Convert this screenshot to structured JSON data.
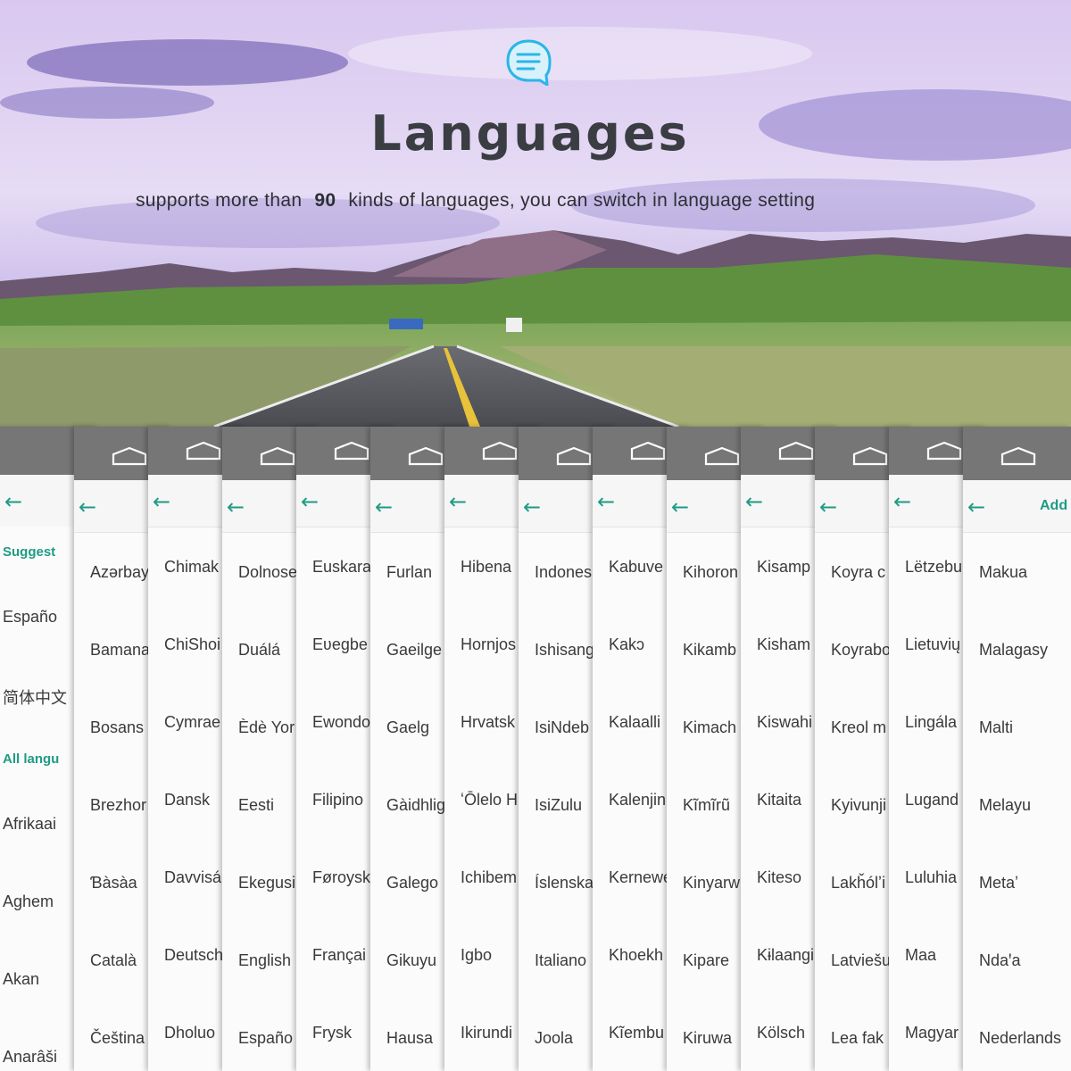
{
  "header": {
    "icon": "chat-bubble-icon",
    "title": "Languages",
    "subtitle_before": "supports more than",
    "language_count": "90",
    "subtitle_after": "kinds of languages, you can switch in language setting"
  },
  "colors": {
    "accent": "#1f9b84",
    "nav_bar": "#767676",
    "title": "#3a3d42",
    "icon": "#29b6e8"
  },
  "panels": [
    {
      "header_extra": "",
      "items": [
        {
          "label": "Suggest",
          "section": true
        },
        {
          "label": "Españo"
        },
        {
          "label": "简体中文"
        },
        {
          "label": "All langu",
          "section": true
        },
        {
          "label": "Afrikaai"
        },
        {
          "label": "Aghem"
        },
        {
          "label": "Akan"
        },
        {
          "label": "Anarâši"
        }
      ]
    },
    {
      "header_extra": "",
      "items": [
        {
          "label": "Azərbay"
        },
        {
          "label": "Bamana"
        },
        {
          "label": "Bosans"
        },
        {
          "label": "Brezhor"
        },
        {
          "label": "Ɓàsàa"
        },
        {
          "label": "Català"
        },
        {
          "label": "Čeština"
        }
      ]
    },
    {
      "header_extra": "",
      "items": [
        {
          "label": "Chimak"
        },
        {
          "label": "ChiShoi"
        },
        {
          "label": "Cymrae"
        },
        {
          "label": "Dansk"
        },
        {
          "label": "Davvisá"
        },
        {
          "label": "Deutsch"
        },
        {
          "label": "Dholuo"
        }
      ]
    },
    {
      "header_extra": "",
      "items": [
        {
          "label": "Dolnose"
        },
        {
          "label": "Duálá"
        },
        {
          "label": "Èdè Yor"
        },
        {
          "label": "Eesti"
        },
        {
          "label": "Ekegusi"
        },
        {
          "label": "English"
        },
        {
          "label": "Españo"
        }
      ]
    },
    {
      "header_extra": "",
      "items": [
        {
          "label": "Euskara"
        },
        {
          "label": "Eʋegbe"
        },
        {
          "label": "Ewondo"
        },
        {
          "label": "Filipino"
        },
        {
          "label": "Føroysk"
        },
        {
          "label": "Françai"
        },
        {
          "label": "Frysk"
        }
      ]
    },
    {
      "header_extra": "",
      "items": [
        {
          "label": "Furlan"
        },
        {
          "label": "Gaeilge"
        },
        {
          "label": "Gaelg"
        },
        {
          "label": "Gàidhlig"
        },
        {
          "label": "Galego"
        },
        {
          "label": "Gikuyu"
        },
        {
          "label": "Hausa"
        }
      ]
    },
    {
      "header_extra": "",
      "items": [
        {
          "label": "Hibena"
        },
        {
          "label": "Hornjos"
        },
        {
          "label": "Hrvatsk"
        },
        {
          "label": "ʻŌlelo H"
        },
        {
          "label": "Ichibem"
        },
        {
          "label": "Igbo"
        },
        {
          "label": "Ikirundi"
        }
      ]
    },
    {
      "header_extra": "",
      "items": [
        {
          "label": "Indones"
        },
        {
          "label": "Ishisang"
        },
        {
          "label": "IsiNdeb"
        },
        {
          "label": "IsiZulu"
        },
        {
          "label": "Íslenska"
        },
        {
          "label": "Italiano"
        },
        {
          "label": "Joola"
        }
      ]
    },
    {
      "header_extra": "",
      "items": [
        {
          "label": "Kabuve"
        },
        {
          "label": "Kakɔ"
        },
        {
          "label": "Kalaalli"
        },
        {
          "label": "Kalenjin"
        },
        {
          "label": "Kernewe"
        },
        {
          "label": "Khoekh"
        },
        {
          "label": "Kĩembu"
        }
      ]
    },
    {
      "header_extra": "",
      "items": [
        {
          "label": "Kihoron"
        },
        {
          "label": "Kikamb"
        },
        {
          "label": "Kimach"
        },
        {
          "label": "Kĩmĩrũ"
        },
        {
          "label": "Kinyarw"
        },
        {
          "label": "Kipare"
        },
        {
          "label": "Kiruwa"
        }
      ]
    },
    {
      "header_extra": "",
      "items": [
        {
          "label": "Kisamp"
        },
        {
          "label": "Kisham"
        },
        {
          "label": "Kiswahi"
        },
        {
          "label": "Kitaita"
        },
        {
          "label": "Kiteso"
        },
        {
          "label": "Kɨlaangi"
        },
        {
          "label": "Kölsch"
        }
      ]
    },
    {
      "header_extra": "",
      "items": [
        {
          "label": "Koyra c"
        },
        {
          "label": "Koyrabo"
        },
        {
          "label": "Kreol m"
        },
        {
          "label": "Kyivunji"
        },
        {
          "label": "Lakȟólʼi"
        },
        {
          "label": "Latviešu"
        },
        {
          "label": "Lea fak"
        }
      ]
    },
    {
      "header_extra": "",
      "items": [
        {
          "label": "Lëtzebu"
        },
        {
          "label": "Lietuvių"
        },
        {
          "label": "Lingála"
        },
        {
          "label": "Lugand"
        },
        {
          "label": "Luluhia"
        },
        {
          "label": "Maa"
        },
        {
          "label": "Magyar"
        }
      ]
    },
    {
      "header_extra": "Add a la",
      "items": [
        {
          "label": "Makua"
        },
        {
          "label": "Malagasy"
        },
        {
          "label": "Malti"
        },
        {
          "label": "Melayu"
        },
        {
          "label": "Metaʼ"
        },
        {
          "label": "Ndaꞌa"
        },
        {
          "label": "Nederlands"
        }
      ]
    }
  ]
}
